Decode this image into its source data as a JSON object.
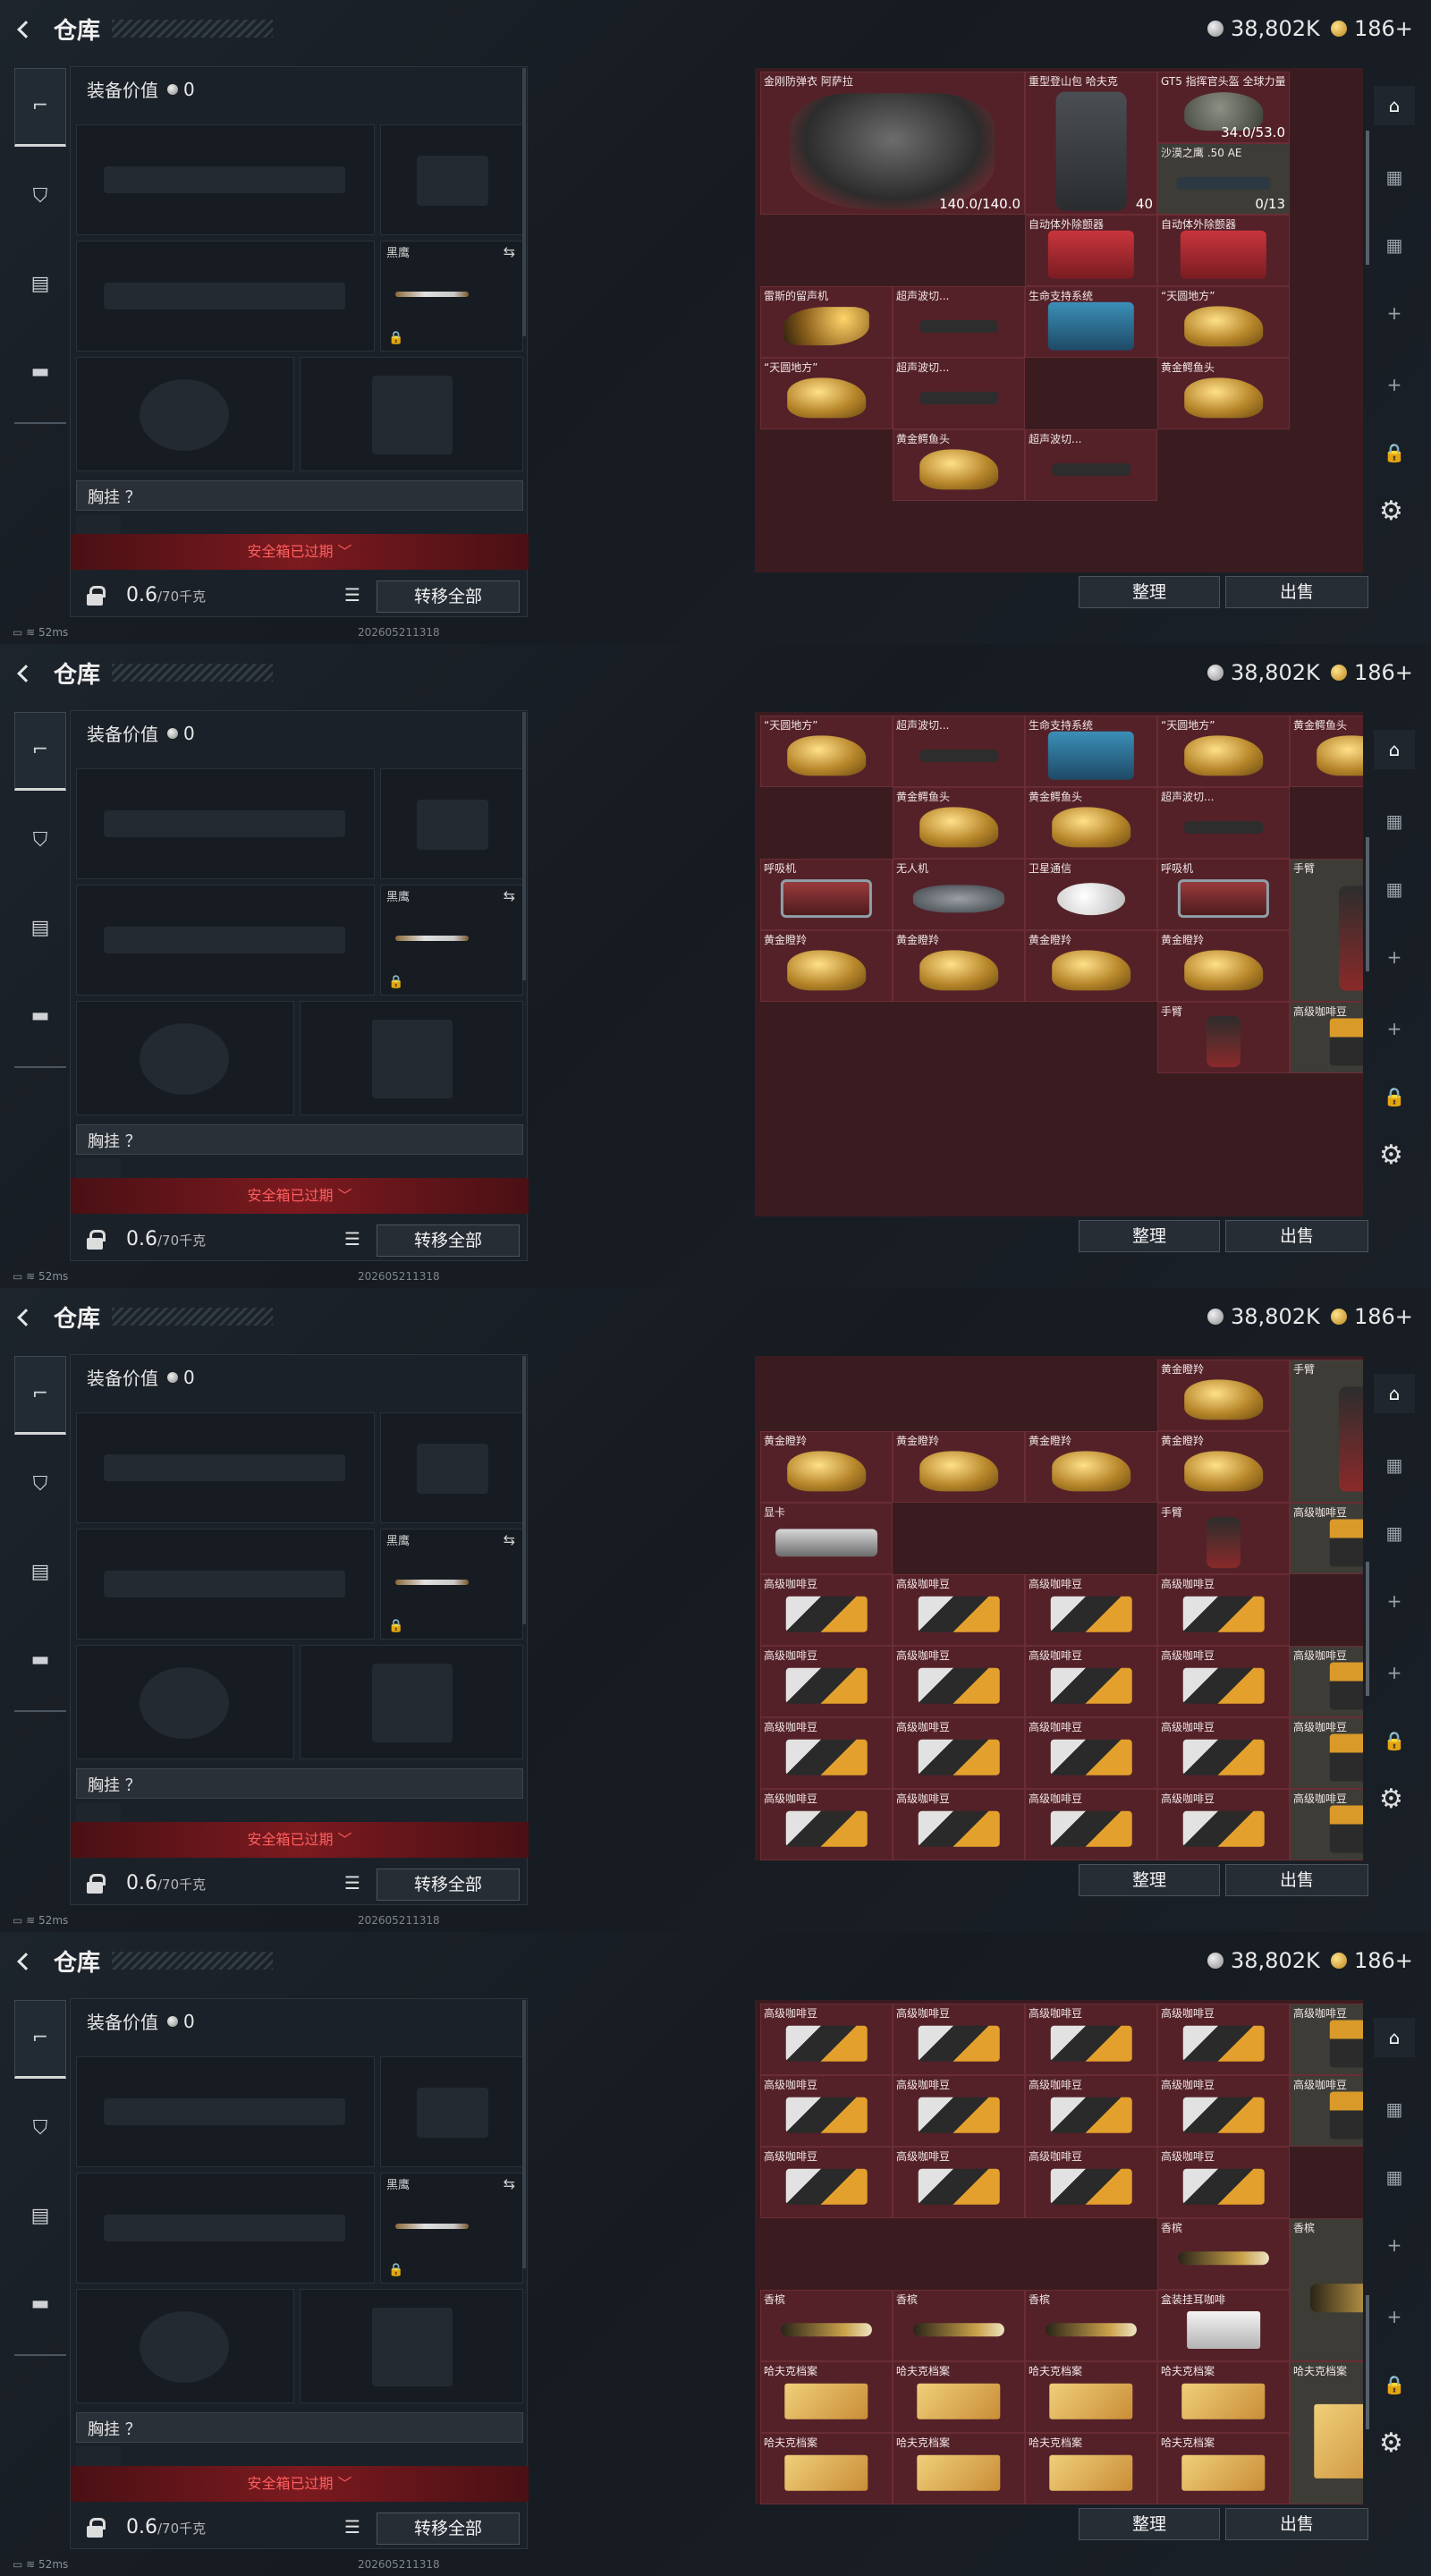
{
  "header": {
    "title": "仓库",
    "silver": "38,802K",
    "gold": "186+"
  },
  "equipment": {
    "value_label": "装备价值",
    "value": "0",
    "knife_label": "黑鹰",
    "chest_label": "胸挂 ？",
    "safebox_expired": "安全箱已过期",
    "weight_current": "0.6",
    "weight_max": "/70千克",
    "transfer_all": "转移全部"
  },
  "actions": {
    "sort": "整理",
    "sell": "出售"
  },
  "status": {
    "ping": "52ms",
    "build": "202605211318"
  },
  "icons": {
    "back": "back-arrow-icon",
    "silver_coin": "silver-coin-icon",
    "gold_coin": "gold-coin-icon",
    "settings": "gear-icon"
  },
  "screens": [
    {
      "cells": [
        {
          "name": "金刚防弹衣 阿萨拉",
          "art": "armor",
          "c": 1,
          "r": 1,
          "w": 2,
          "h": 2,
          "val": "140.0/140.0"
        },
        {
          "name": "重型登山包 哈夫克",
          "art": "pack",
          "c": 3,
          "r": 1,
          "w": 1,
          "h": 2,
          "val": "40"
        },
        {
          "name": "GT5 指挥官头盔 全球力量",
          "art": "helm",
          "c": 4,
          "r": 1,
          "w": 1,
          "h": 1,
          "val": "34.0/53.0"
        },
        {
          "name": "沙漠之鹰 .50 AE",
          "art": "gun",
          "c": 4,
          "r": 2,
          "w": 1,
          "h": 1,
          "val": "0/13",
          "dark": true
        },
        {
          "name": "自动体外除颤器",
          "art": "red",
          "c": 3,
          "r": 3,
          "w": 1,
          "h": 1
        },
        {
          "name": "自动体外除颤器",
          "art": "red",
          "c": 4,
          "r": 3,
          "w": 1,
          "h": 1
        },
        {
          "name": "雷斯的留声机",
          "art": "horn",
          "c": 1,
          "r": 4,
          "w": 1,
          "h": 1
        },
        {
          "name": "超声波切...",
          "art": "scope",
          "c": 2,
          "r": 4,
          "w": 1,
          "h": 1
        },
        {
          "name": "生命支持系统",
          "art": "blue",
          "c": 3,
          "r": 4,
          "w": 1,
          "h": 1
        },
        {
          "name": "“天圆地方”",
          "art": "gold",
          "c": 4,
          "r": 4,
          "w": 1,
          "h": 1
        },
        {
          "name": "“天圆地方”",
          "art": "gold",
          "c": 1,
          "r": 5,
          "w": 1,
          "h": 1
        },
        {
          "name": "超声波切...",
          "art": "scope",
          "c": 2,
          "r": 5,
          "w": 1,
          "h": 1
        },
        {
          "name": "黄金鳄鱼头",
          "art": "gold",
          "c": 4,
          "r": 5,
          "w": 1,
          "h": 1
        },
        {
          "name": "黄金鳄鱼头",
          "art": "gold",
          "c": 2,
          "r": 6,
          "w": 1,
          "h": 1
        },
        {
          "name": "超声波切...",
          "art": "scope",
          "c": 3,
          "r": 6,
          "w": 1,
          "h": 1
        }
      ]
    },
    {
      "cells": [
        {
          "name": "“天圆地方”",
          "art": "gold",
          "c": 1,
          "r": 1,
          "w": 1,
          "h": 1
        },
        {
          "name": "超声波切...",
          "art": "scope",
          "c": 2,
          "r": 1,
          "w": 1,
          "h": 1
        },
        {
          "name": "生命支持系统",
          "art": "blue",
          "c": 3,
          "r": 1,
          "w": 1,
          "h": 1
        },
        {
          "name": "“天圆地方”",
          "art": "gold",
          "c": 4,
          "r": 1,
          "w": 1,
          "h": 1
        },
        {
          "name": "黄金鳄鱼头",
          "art": "gold",
          "c": 5,
          "r": 1,
          "w": 1,
          "h": 1
        },
        {
          "name": "黄金鳄鱼头",
          "art": "gold",
          "c": 2,
          "r": 2,
          "w": 1,
          "h": 1
        },
        {
          "name": "黄金鳄鱼头",
          "art": "gold",
          "c": 3,
          "r": 2,
          "w": 1,
          "h": 1
        },
        {
          "name": "超声波切...",
          "art": "scope",
          "c": 4,
          "r": 2,
          "w": 1,
          "h": 1
        },
        {
          "name": "呼吸机",
          "art": "radio",
          "c": 1,
          "r": 3,
          "w": 1,
          "h": 1
        },
        {
          "name": "无人机",
          "art": "drone",
          "c": 2,
          "r": 3,
          "w": 1,
          "h": 1
        },
        {
          "name": "卫星通信",
          "art": "dish",
          "c": 3,
          "r": 3,
          "w": 1,
          "h": 1
        },
        {
          "name": "呼吸机",
          "art": "radio",
          "c": 4,
          "r": 3,
          "w": 1,
          "h": 1
        },
        {
          "name": "手臂",
          "art": "arm",
          "c": 5,
          "r": 3,
          "w": 1,
          "h": 2,
          "dark": true
        },
        {
          "name": "黄金瞪羚",
          "art": "gold",
          "c": 1,
          "r": 4,
          "w": 1,
          "h": 1
        },
        {
          "name": "黄金瞪羚",
          "art": "gold",
          "c": 2,
          "r": 4,
          "w": 1,
          "h": 1
        },
        {
          "name": "黄金瞪羚",
          "art": "gold",
          "c": 3,
          "r": 4,
          "w": 1,
          "h": 1
        },
        {
          "name": "黄金瞪羚",
          "art": "gold",
          "c": 4,
          "r": 4,
          "w": 1,
          "h": 1
        },
        {
          "name": "手臂",
          "art": "arm",
          "c": 4,
          "r": 5,
          "w": 1,
          "h": 1
        },
        {
          "name": "高级咖啡豆",
          "art": "bag",
          "c": 5,
          "r": 5,
          "w": 1,
          "h": 1,
          "dark": true
        }
      ]
    },
    {
      "cells": [
        {
          "name": "黄金瞪羚",
          "art": "gold",
          "c": 4,
          "r": 1,
          "w": 1,
          "h": 1
        },
        {
          "name": "手臂",
          "art": "arm",
          "c": 5,
          "r": 1,
          "w": 1,
          "h": 2,
          "dark": true
        },
        {
          "name": "黄金瞪羚",
          "art": "gold",
          "c": 1,
          "r": 2,
          "w": 1,
          "h": 1
        },
        {
          "name": "黄金瞪羚",
          "art": "gold",
          "c": 2,
          "r": 2,
          "w": 1,
          "h": 1
        },
        {
          "name": "黄金瞪羚",
          "art": "gold",
          "c": 3,
          "r": 2,
          "w": 1,
          "h": 1
        },
        {
          "name": "黄金瞪羚",
          "art": "gold",
          "c": 4,
          "r": 2,
          "w": 1,
          "h": 1
        },
        {
          "name": "显卡",
          "art": "gpu",
          "c": 1,
          "r": 3,
          "w": 1,
          "h": 1
        },
        {
          "name": "手臂",
          "art": "arm",
          "c": 4,
          "r": 3,
          "w": 1,
          "h": 1
        },
        {
          "name": "高级咖啡豆",
          "art": "bag",
          "c": 5,
          "r": 3,
          "w": 1,
          "h": 1,
          "dark": true
        },
        {
          "name": "高级咖啡豆",
          "art": "coffee",
          "c": 1,
          "r": 4,
          "w": 1,
          "h": 1
        },
        {
          "name": "高级咖啡豆",
          "art": "coffee",
          "c": 2,
          "r": 4,
          "w": 1,
          "h": 1
        },
        {
          "name": "高级咖啡豆",
          "art": "coffee",
          "c": 3,
          "r": 4,
          "w": 1,
          "h": 1
        },
        {
          "name": "高级咖啡豆",
          "art": "coffee",
          "c": 4,
          "r": 4,
          "w": 1,
          "h": 1
        },
        {
          "name": "高级咖啡豆",
          "art": "coffee",
          "c": 1,
          "r": 5,
          "w": 1,
          "h": 1
        },
        {
          "name": "高级咖啡豆",
          "art": "coffee",
          "c": 2,
          "r": 5,
          "w": 1,
          "h": 1
        },
        {
          "name": "高级咖啡豆",
          "art": "coffee",
          "c": 3,
          "r": 5,
          "w": 1,
          "h": 1
        },
        {
          "name": "高级咖啡豆",
          "art": "coffee",
          "c": 4,
          "r": 5,
          "w": 1,
          "h": 1
        },
        {
          "name": "高级咖啡豆",
          "art": "bag",
          "c": 5,
          "r": 5,
          "w": 1,
          "h": 1,
          "dark": true
        },
        {
          "name": "高级咖啡豆",
          "art": "coffee",
          "c": 1,
          "r": 6,
          "w": 1,
          "h": 1
        },
        {
          "name": "高级咖啡豆",
          "art": "coffee",
          "c": 2,
          "r": 6,
          "w": 1,
          "h": 1
        },
        {
          "name": "高级咖啡豆",
          "art": "coffee",
          "c": 3,
          "r": 6,
          "w": 1,
          "h": 1
        },
        {
          "name": "高级咖啡豆",
          "art": "coffee",
          "c": 4,
          "r": 6,
          "w": 1,
          "h": 1
        },
        {
          "name": "高级咖啡豆",
          "art": "bag",
          "c": 5,
          "r": 6,
          "w": 1,
          "h": 1,
          "dark": true
        },
        {
          "name": "高级咖啡豆",
          "art": "coffee",
          "c": 1,
          "r": 7,
          "w": 1,
          "h": 1
        },
        {
          "name": "高级咖啡豆",
          "art": "coffee",
          "c": 2,
          "r": 7,
          "w": 1,
          "h": 1
        },
        {
          "name": "高级咖啡豆",
          "art": "coffee",
          "c": 3,
          "r": 7,
          "w": 1,
          "h": 1
        },
        {
          "name": "高级咖啡豆",
          "art": "coffee",
          "c": 4,
          "r": 7,
          "w": 1,
          "h": 1
        },
        {
          "name": "高级咖啡豆",
          "art": "bag",
          "c": 5,
          "r": 7,
          "w": 1,
          "h": 1,
          "dark": true
        }
      ]
    },
    {
      "cells": [
        {
          "name": "高级咖啡豆",
          "art": "coffee",
          "c": 1,
          "r": 1,
          "w": 1,
          "h": 1
        },
        {
          "name": "高级咖啡豆",
          "art": "coffee",
          "c": 2,
          "r": 1,
          "w": 1,
          "h": 1
        },
        {
          "name": "高级咖啡豆",
          "art": "coffee",
          "c": 3,
          "r": 1,
          "w": 1,
          "h": 1
        },
        {
          "name": "高级咖啡豆",
          "art": "coffee",
          "c": 4,
          "r": 1,
          "w": 1,
          "h": 1
        },
        {
          "name": "高级咖啡豆",
          "art": "bag",
          "c": 5,
          "r": 1,
          "w": 1,
          "h": 1,
          "dark": true
        },
        {
          "name": "高级咖啡豆",
          "art": "coffee",
          "c": 1,
          "r": 2,
          "w": 1,
          "h": 1
        },
        {
          "name": "高级咖啡豆",
          "art": "coffee",
          "c": 2,
          "r": 2,
          "w": 1,
          "h": 1
        },
        {
          "name": "高级咖啡豆",
          "art": "coffee",
          "c": 3,
          "r": 2,
          "w": 1,
          "h": 1
        },
        {
          "name": "高级咖啡豆",
          "art": "coffee",
          "c": 4,
          "r": 2,
          "w": 1,
          "h": 1
        },
        {
          "name": "高级咖啡豆",
          "art": "bag",
          "c": 5,
          "r": 2,
          "w": 1,
          "h": 1,
          "dark": true
        },
        {
          "name": "高级咖啡豆",
          "art": "coffee",
          "c": 1,
          "r": 3,
          "w": 1,
          "h": 1
        },
        {
          "name": "高级咖啡豆",
          "art": "coffee",
          "c": 2,
          "r": 3,
          "w": 1,
          "h": 1
        },
        {
          "name": "高级咖啡豆",
          "art": "coffee",
          "c": 3,
          "r": 3,
          "w": 1,
          "h": 1
        },
        {
          "name": "高级咖啡豆",
          "art": "coffee",
          "c": 4,
          "r": 3,
          "w": 1,
          "h": 1
        },
        {
          "name": "香槟",
          "art": "bottle",
          "c": 4,
          "r": 4,
          "w": 1,
          "h": 1
        },
        {
          "name": "香槟",
          "art": "bottle",
          "c": 5,
          "r": 4,
          "w": 1,
          "h": 2,
          "dark": true
        },
        {
          "name": "香槟",
          "art": "bottle",
          "c": 1,
          "r": 5,
          "w": 1,
          "h": 1
        },
        {
          "name": "香槟",
          "art": "bottle",
          "c": 2,
          "r": 5,
          "w": 1,
          "h": 1
        },
        {
          "name": "香槟",
          "art": "bottle",
          "c": 3,
          "r": 5,
          "w": 1,
          "h": 1
        },
        {
          "name": "盒装挂耳咖啡",
          "art": "box",
          "c": 4,
          "r": 5,
          "w": 1,
          "h": 1
        },
        {
          "name": "哈夫克档案",
          "art": "file",
          "c": 1,
          "r": 6,
          "w": 1,
          "h": 1
        },
        {
          "name": "哈夫克档案",
          "art": "file",
          "c": 2,
          "r": 6,
          "w": 1,
          "h": 1
        },
        {
          "name": "哈夫克档案",
          "art": "file",
          "c": 3,
          "r": 6,
          "w": 1,
          "h": 1
        },
        {
          "name": "哈夫克档案",
          "art": "file",
          "c": 4,
          "r": 6,
          "w": 1,
          "h": 1
        },
        {
          "name": "哈夫克档案",
          "art": "file",
          "c": 5,
          "r": 6,
          "w": 1,
          "h": 2,
          "dark": true
        },
        {
          "name": "哈夫克档案",
          "art": "file",
          "c": 1,
          "r": 7,
          "w": 1,
          "h": 1
        },
        {
          "name": "哈夫克档案",
          "art": "file",
          "c": 2,
          "r": 7,
          "w": 1,
          "h": 1
        },
        {
          "name": "哈夫克档案",
          "art": "file",
          "c": 3,
          "r": 7,
          "w": 1,
          "h": 1
        },
        {
          "name": "哈夫克档案",
          "art": "file",
          "c": 4,
          "r": 7,
          "w": 1,
          "h": 1
        }
      ]
    }
  ]
}
